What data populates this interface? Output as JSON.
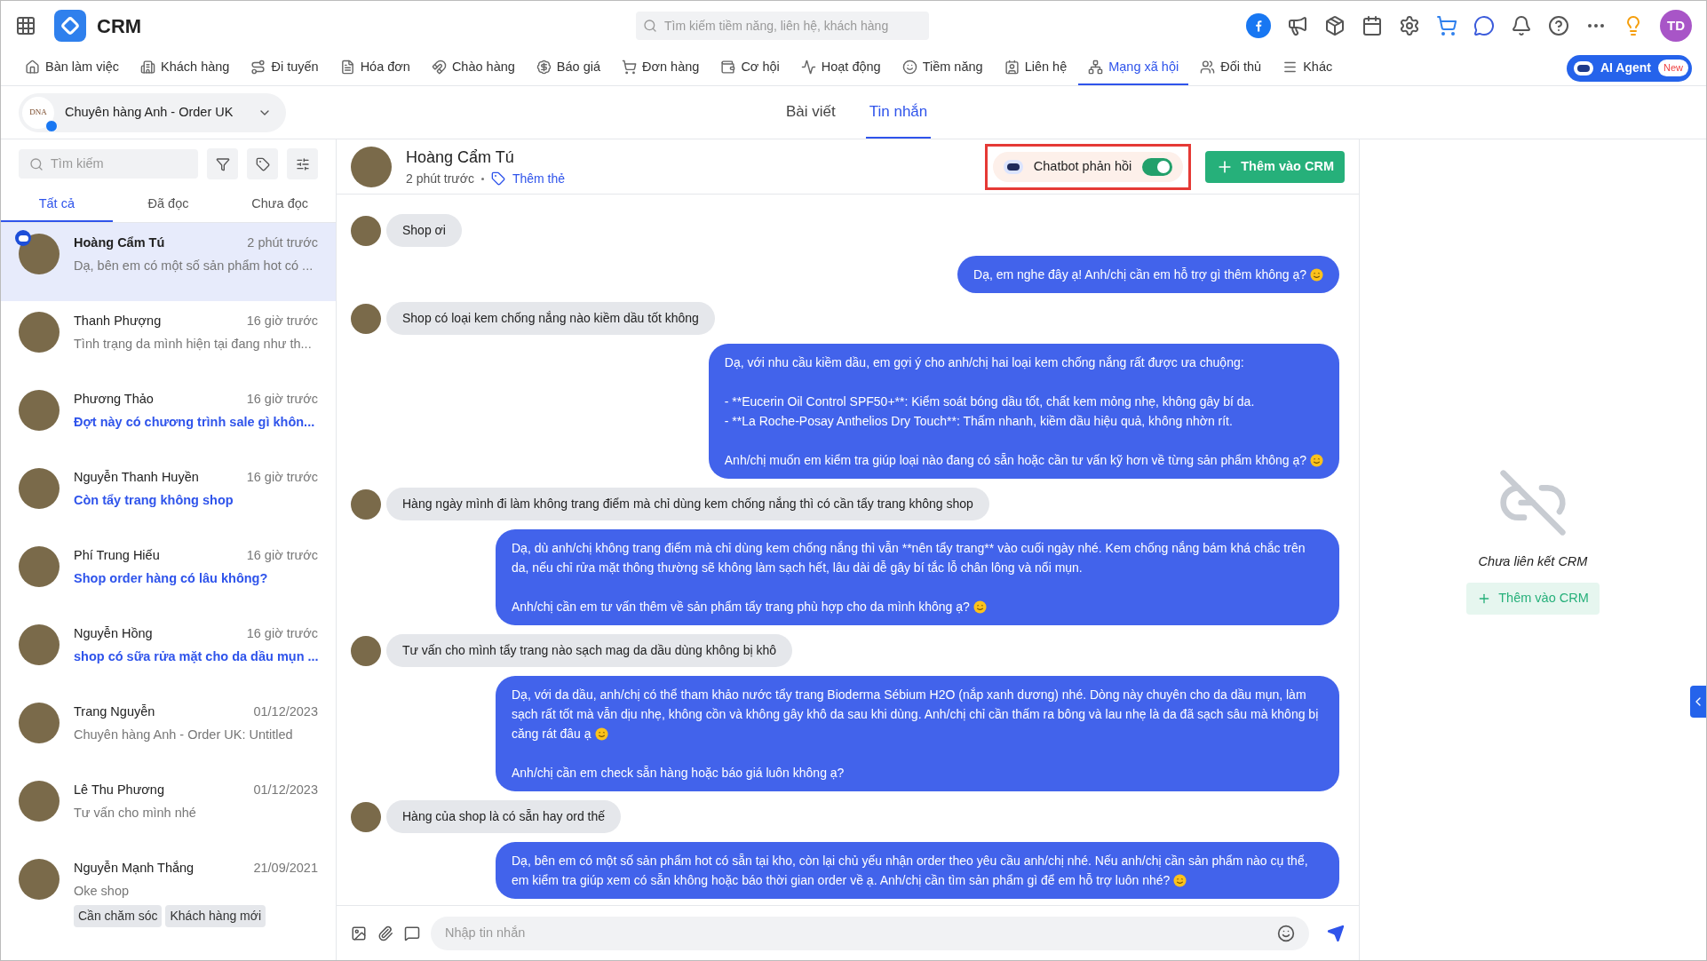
{
  "app": {
    "title": "CRM",
    "search_placeholder": "Tìm kiếm tiềm năng, liên hệ, khách hàng",
    "user_initials": "TD"
  },
  "nav": [
    {
      "label": "Bàn làm việc",
      "selected": false
    },
    {
      "label": "Khách hàng",
      "selected": false
    },
    {
      "label": "Đi tuyến",
      "selected": false
    },
    {
      "label": "Hóa đơn",
      "selected": false
    },
    {
      "label": "Chào hàng",
      "selected": false
    },
    {
      "label": "Báo giá",
      "selected": false
    },
    {
      "label": "Đơn hàng",
      "selected": false
    },
    {
      "label": "Cơ hội",
      "selected": false
    },
    {
      "label": "Hoạt động",
      "selected": false
    },
    {
      "label": "Tiềm năng",
      "selected": false
    },
    {
      "label": "Liên hệ",
      "selected": false
    },
    {
      "label": "Mạng xã hội",
      "selected": true
    },
    {
      "label": "Đối thủ",
      "selected": false
    },
    {
      "label": "Khác",
      "selected": false
    }
  ],
  "ai_agent": {
    "label": "AI Agent",
    "badge": "New"
  },
  "page_selector": {
    "label": "Chuyên hàng Anh - Order UK",
    "logo_text": "DNA"
  },
  "view_tabs": [
    {
      "label": "Bài viết",
      "selected": false
    },
    {
      "label": "Tin nhắn",
      "selected": true
    }
  ],
  "sidebar": {
    "search_placeholder": "Tìm kiếm",
    "tabs": [
      {
        "label": "Tất cả",
        "selected": true
      },
      {
        "label": "Đã đọc",
        "selected": false
      },
      {
        "label": "Chưa đọc",
        "selected": false
      }
    ],
    "conversations": [
      {
        "name": "Hoàng Cẩm Tú",
        "time": "2 phút trước",
        "preview": "Dạ, bên em có một số sản phẩm hot có ...",
        "unread": false,
        "selected": true,
        "bot": true
      },
      {
        "name": "Thanh Phượng",
        "time": "16 giờ trước",
        "preview": "Tình trạng da mình hiện tại đang như th...",
        "unread": false,
        "selected": false,
        "bot": false
      },
      {
        "name": "Phương Thảo",
        "time": "16 giờ trước",
        "preview": "Đợt này có chương trình sale gì khôn...",
        "unread": true,
        "selected": false,
        "bot": false
      },
      {
        "name": "Nguyễn Thanh Huyền",
        "time": "16 giờ trước",
        "preview": "Còn tẩy trang không shop",
        "unread": true,
        "selected": false,
        "bot": false
      },
      {
        "name": "Phí Trung Hiếu",
        "time": "16 giờ trước",
        "preview": "Shop order hàng có lâu không?",
        "unread": true,
        "selected": false,
        "bot": false
      },
      {
        "name": "Nguyễn Hồng",
        "time": "16 giờ trước",
        "preview": "shop có sữa rửa mặt cho da dầu mụn ...",
        "unread": true,
        "selected": false,
        "bot": false
      },
      {
        "name": "Trang Nguyễn",
        "time": "01/12/2023",
        "preview": "Chuyên hàng Anh - Order UK: Untitled",
        "unread": false,
        "selected": false,
        "bot": false
      },
      {
        "name": "Lê Thu Phương",
        "time": "01/12/2023",
        "preview": "Tư vấn cho mình nhé",
        "unread": false,
        "selected": false,
        "bot": false
      },
      {
        "name": "Nguyễn Mạnh Thắng",
        "time": "21/09/2021",
        "preview": "Oke shop",
        "unread": false,
        "selected": false,
        "bot": false,
        "tags": [
          "Cần chăm sóc",
          "Khách hàng mới"
        ]
      }
    ]
  },
  "chat": {
    "name": "Hoàng Cẩm Tú",
    "time": "2 phút trước",
    "add_tag": "Thêm thẻ",
    "chatbot": {
      "label": "Chatbot phản hồi",
      "on": true
    },
    "add_button": "Thêm vào CRM",
    "messages": [
      {
        "kind": "incoming",
        "text": "Shop ơi"
      },
      {
        "kind": "outgoing",
        "text": "Dạ, em nghe đây ạ! Anh/chị cần em hỗ trợ gì thêm không ạ?",
        "smiley": true
      },
      {
        "kind": "incoming",
        "text": "Shop có loại kem chống nắng nào kiềm dầu tốt không"
      },
      {
        "kind": "outgoing",
        "text": "Dạ, với nhu cầu kiềm dầu, em gợi ý cho anh/chị hai loại kem chống nắng rất được ưa chuộng:\n\n- **Eucerin Oil Control SPF50+**: Kiểm soát bóng dầu tốt, chất kem mỏng nhẹ, không gây bí da.\n- **La Roche-Posay Anthelios Dry Touch**: Thấm nhanh, kiềm dầu hiệu quả, không nhờn rít.\n\nAnh/chị muốn em kiểm tra giúp loại nào đang có sẵn hoặc cần tư vấn kỹ hơn về từng sản phẩm không ạ?",
        "smiley": true
      },
      {
        "kind": "incoming",
        "text": "Hàng ngày mình đi làm không trang điểm mà chỉ dùng kem chống nắng thì có cần tẩy trang không shop"
      },
      {
        "kind": "outgoing",
        "text": "Dạ, dù anh/chị không trang điểm mà chỉ dùng kem chống nắng thì vẫn **nên tẩy trang** vào cuối ngày nhé. Kem chống nắng bám khá chắc trên da, nếu chỉ rửa mặt thông thường sẽ không làm sạch hết, lâu dài dễ gây bí tắc lỗ chân lông và nổi mụn.\n\nAnh/chị cần em tư vấn thêm về sản phẩm tẩy trang phù hợp cho da mình không ạ?",
        "smiley": true
      },
      {
        "kind": "incoming",
        "text": "Tư vấn cho mình tẩy trang nào sạch mag da dầu dùng không bị khô"
      },
      {
        "kind": "outgoing",
        "text": "Dạ, với da dầu, anh/chị có thể tham khảo nước tẩy trang Bioderma Sébium H2O (nắp xanh dương) nhé. Dòng này chuyên cho da dầu mụn, làm sạch rất tốt mà vẫn dịu nhẹ, không cồn và không gây khô da sau khi dùng. Anh/chị chỉ cần thấm ra bông và lau nhẹ là da đã sạch sâu mà không bị căng rát đâu ạ",
        "smiley": true,
        "after": "Anh/chị cần em check sẵn hàng hoặc báo giá luôn không ạ?"
      },
      {
        "kind": "incoming",
        "text": "Hàng của shop là có sẵn hay ord thế"
      },
      {
        "kind": "outgoing",
        "text": "Dạ, bên em có một số sản phẩm hot có sẵn tại kho, còn lại chủ yếu nhận order theo yêu cầu anh/chị nhé. Nếu anh/chị cần sản phẩm nào cụ thể, em kiểm tra giúp xem có sẵn không hoặc báo thời gian order về ạ. Anh/chị cần tìm sản phẩm gì để em hỗ trợ luôn nhé?",
        "smiley": true
      }
    ],
    "composer_placeholder": "Nhập tin nhắn"
  },
  "crm_panel": {
    "status": "Chưa liên kết CRM",
    "button": "Thêm vào CRM"
  }
}
